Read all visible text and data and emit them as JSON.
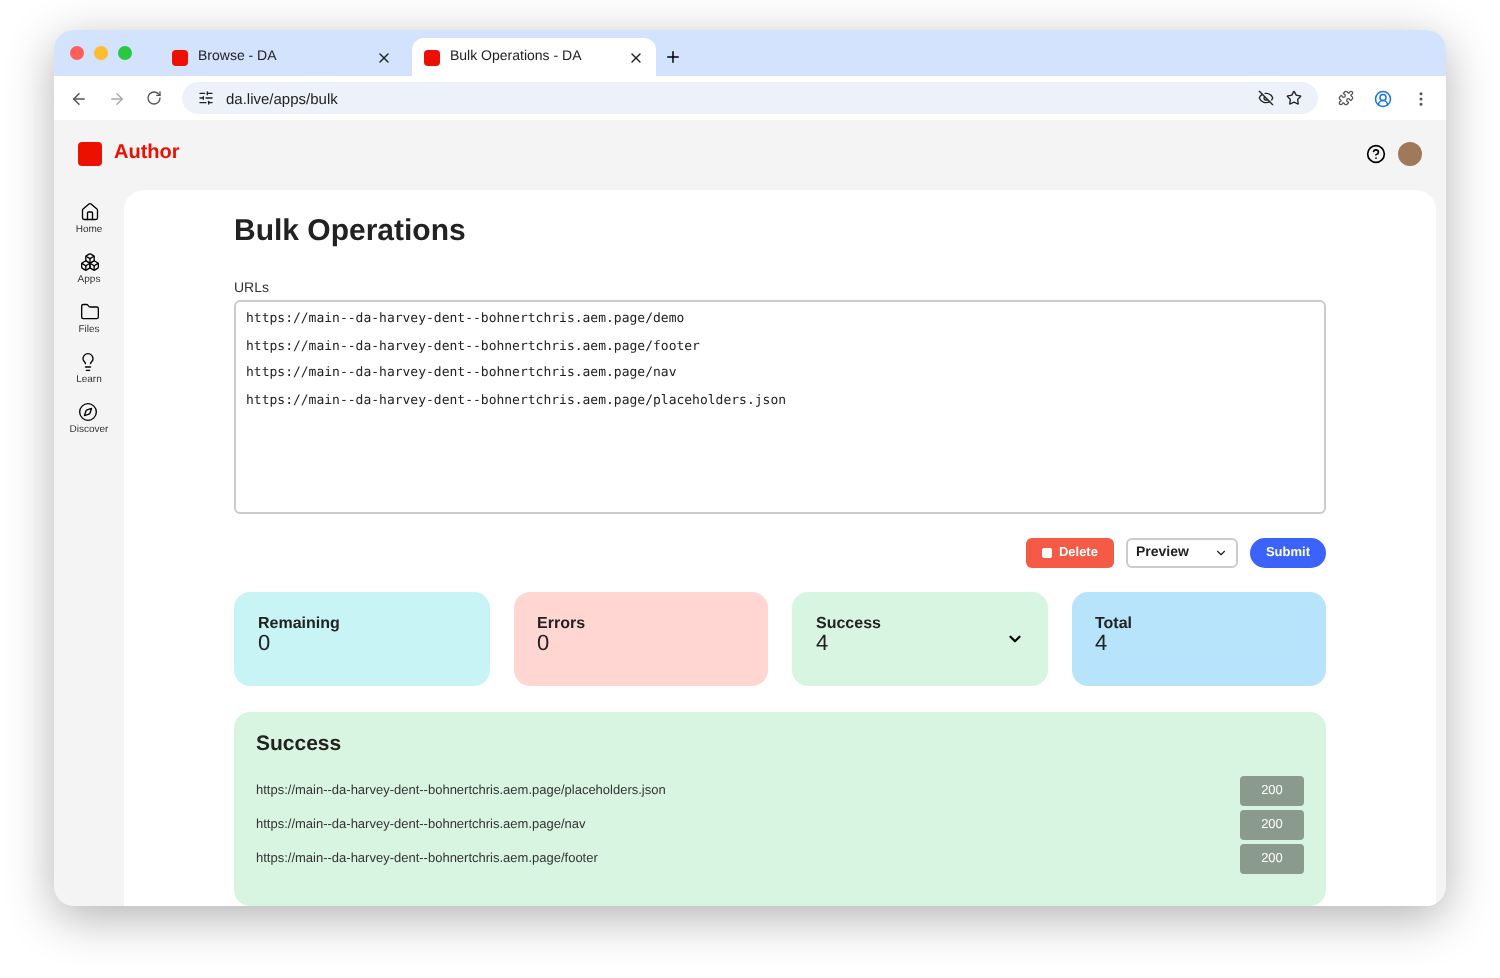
{
  "browser": {
    "tabs": [
      {
        "title": "Browse - DA",
        "selected": false
      },
      {
        "title": "Bulk Operations - DA",
        "selected": true
      }
    ],
    "address": "da.live/apps/bulk"
  },
  "app": {
    "brand": "Author"
  },
  "sidebar": {
    "items": [
      {
        "label": "Home"
      },
      {
        "label": "Apps"
      },
      {
        "label": "Files"
      },
      {
        "label": "Learn"
      },
      {
        "label": "Discover"
      }
    ]
  },
  "page": {
    "title": "Bulk Operations",
    "urls_label": "URLs",
    "urls": [
      "https://main--da-harvey-dent--bohnertchris.aem.page/demo",
      "https://main--da-harvey-dent--bohnertchris.aem.page/footer",
      "https://main--da-harvey-dent--bohnertchris.aem.page/nav",
      "https://main--da-harvey-dent--bohnertchris.aem.page/placeholders.json"
    ],
    "delete_button": "Delete",
    "action_select": "Preview",
    "submit_button": "Submit",
    "stats": [
      {
        "label": "Remaining",
        "value": "0",
        "color": "#c9f4f6",
        "expandable": false
      },
      {
        "label": "Errors",
        "value": "0",
        "color": "#ffd6d1",
        "expandable": false
      },
      {
        "label": "Success",
        "value": "4",
        "color": "#d8f5e1",
        "expandable": true
      },
      {
        "label": "Total",
        "value": "4",
        "color": "#b8e4fb",
        "expandable": false
      }
    ],
    "results": {
      "title": "Success",
      "rows": [
        {
          "url": "https://main--da-harvey-dent--bohnertchris.aem.page/placeholders.json",
          "status": "200"
        },
        {
          "url": "https://main--da-harvey-dent--bohnertchris.aem.page/nav",
          "status": "200"
        },
        {
          "url": "https://main--da-harvey-dent--bohnertchris.aem.page/footer",
          "status": "200"
        }
      ]
    }
  }
}
